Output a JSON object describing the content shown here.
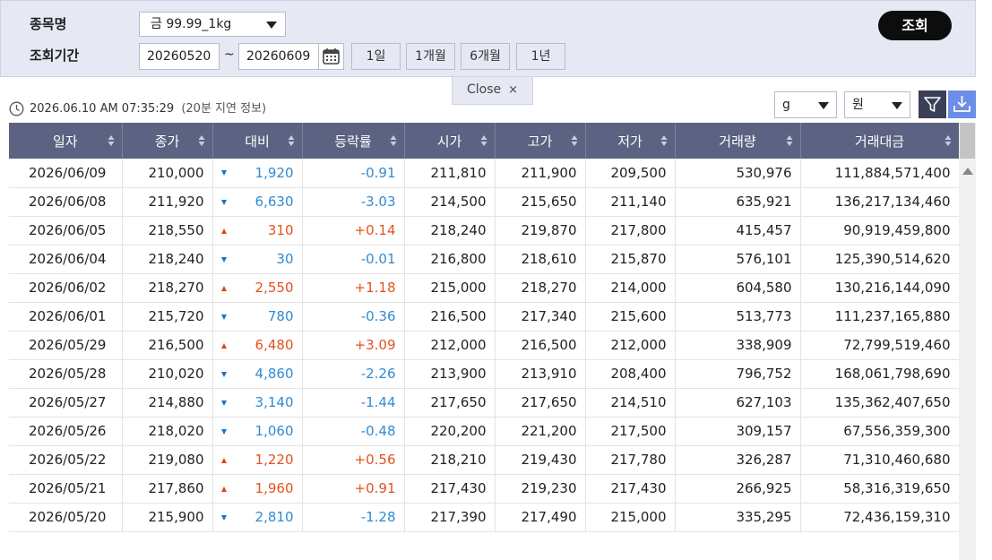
{
  "search": {
    "item_label": "종목명",
    "item_value": "금 99.99_1kg",
    "period_label": "조회기간",
    "date_from": "20260520",
    "date_sep": "~",
    "date_to": "20260609",
    "period_buttons": [
      "1일",
      "1개월",
      "6개월",
      "1년"
    ],
    "query_button": "조회"
  },
  "close_tab": {
    "label": "Close",
    "x": "×"
  },
  "timestamp": "2026.06.10 AM 07:35:29",
  "delay_note": "(20분 지연 정보)",
  "unit_weight": "g",
  "unit_currency": "원",
  "icons": [
    "clock-icon",
    "calendar-icon",
    "filter-icon",
    "download-icon",
    "sort-icon",
    "triangle-up-icon",
    "triangle-down-icon"
  ],
  "colors": {
    "up": "#e4521e",
    "down": "#2f8bd4",
    "header": "#5b6282",
    "query_button": "#0d0d0d"
  },
  "table": {
    "columns": [
      "일자",
      "종가",
      "대비",
      "등락률",
      "시가",
      "고가",
      "저가",
      "거래량",
      "거래대금"
    ],
    "rows": [
      {
        "date": "2026/06/09",
        "close": "210,000",
        "dir": "down",
        "diff": "1,920",
        "rate": "-0.91",
        "open": "211,810",
        "high": "211,900",
        "low": "209,500",
        "volume": "530,976",
        "amount": "111,884,571,400"
      },
      {
        "date": "2026/06/08",
        "close": "211,920",
        "dir": "down",
        "diff": "6,630",
        "rate": "-3.03",
        "open": "214,500",
        "high": "215,650",
        "low": "211,140",
        "volume": "635,921",
        "amount": "136,217,134,460"
      },
      {
        "date": "2026/06/05",
        "close": "218,550",
        "dir": "up",
        "diff": "310",
        "rate": "+0.14",
        "open": "218,240",
        "high": "219,870",
        "low": "217,800",
        "volume": "415,457",
        "amount": "90,919,459,800"
      },
      {
        "date": "2026/06/04",
        "close": "218,240",
        "dir": "down",
        "diff": "30",
        "rate": "-0.01",
        "open": "216,800",
        "high": "218,610",
        "low": "215,870",
        "volume": "576,101",
        "amount": "125,390,514,620"
      },
      {
        "date": "2026/06/02",
        "close": "218,270",
        "dir": "up",
        "diff": "2,550",
        "rate": "+1.18",
        "open": "215,000",
        "high": "218,270",
        "low": "214,000",
        "volume": "604,580",
        "amount": "130,216,144,090"
      },
      {
        "date": "2026/06/01",
        "close": "215,720",
        "dir": "down",
        "diff": "780",
        "rate": "-0.36",
        "open": "216,500",
        "high": "217,340",
        "low": "215,600",
        "volume": "513,773",
        "amount": "111,237,165,880"
      },
      {
        "date": "2026/05/29",
        "close": "216,500",
        "dir": "up",
        "diff": "6,480",
        "rate": "+3.09",
        "open": "212,000",
        "high": "216,500",
        "low": "212,000",
        "volume": "338,909",
        "amount": "72,799,519,460"
      },
      {
        "date": "2026/05/28",
        "close": "210,020",
        "dir": "down",
        "diff": "4,860",
        "rate": "-2.26",
        "open": "213,900",
        "high": "213,910",
        "low": "208,400",
        "volume": "796,752",
        "amount": "168,061,798,690"
      },
      {
        "date": "2026/05/27",
        "close": "214,880",
        "dir": "down",
        "diff": "3,140",
        "rate": "-1.44",
        "open": "217,650",
        "high": "217,650",
        "low": "214,510",
        "volume": "627,103",
        "amount": "135,362,407,650"
      },
      {
        "date": "2026/05/26",
        "close": "218,020",
        "dir": "down",
        "diff": "1,060",
        "rate": "-0.48",
        "open": "220,200",
        "high": "221,200",
        "low": "217,500",
        "volume": "309,157",
        "amount": "67,556,359,300"
      },
      {
        "date": "2026/05/22",
        "close": "219,080",
        "dir": "up",
        "diff": "1,220",
        "rate": "+0.56",
        "open": "218,210",
        "high": "219,430",
        "low": "217,780",
        "volume": "326,287",
        "amount": "71,310,460,680"
      },
      {
        "date": "2026/05/21",
        "close": "217,860",
        "dir": "up",
        "diff": "1,960",
        "rate": "+0.91",
        "open": "217,430",
        "high": "219,230",
        "low": "217,430",
        "volume": "266,925",
        "amount": "58,316,319,650"
      },
      {
        "date": "2026/05/20",
        "close": "215,900",
        "dir": "down",
        "diff": "2,810",
        "rate": "-1.28",
        "open": "217,390",
        "high": "217,490",
        "low": "215,000",
        "volume": "335,295",
        "amount": "72,436,159,310"
      }
    ]
  }
}
